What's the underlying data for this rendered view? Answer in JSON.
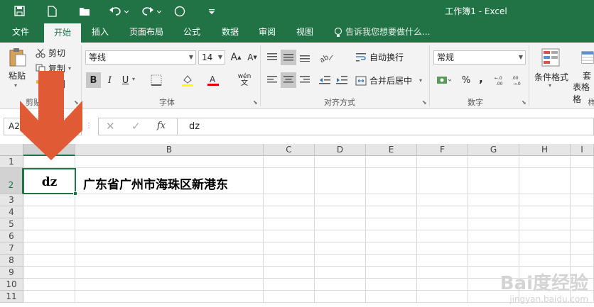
{
  "window": {
    "title": "工作簿1 - Excel"
  },
  "tabs": [
    {
      "label": "文件"
    },
    {
      "label": "开始"
    },
    {
      "label": "插入"
    },
    {
      "label": "页面布局"
    },
    {
      "label": "公式"
    },
    {
      "label": "数据"
    },
    {
      "label": "审阅"
    },
    {
      "label": "视图"
    }
  ],
  "tell_me": "告诉我您想要做什么...",
  "clipboard": {
    "paste": "粘贴",
    "cut": "剪切",
    "copy": "复制",
    "format_painter": "式刷",
    "group": "剪贴"
  },
  "font": {
    "name": "等线",
    "size": "14",
    "bold": "B",
    "italic": "I",
    "underline": "U",
    "phonetic": "wén",
    "group": "字体"
  },
  "alignment": {
    "wrap": "自动换行",
    "merge": "合并后居中",
    "group": "对齐方式"
  },
  "number": {
    "format": "常规",
    "percent": "%",
    "comma": ",",
    "group": "数字"
  },
  "styles": {
    "conditional": "条件格式",
    "table1": "套",
    "table2": "表格格",
    "group": "样"
  },
  "formula_bar": {
    "name_box": "A2",
    "fx": "fx",
    "content": "dz"
  },
  "columns": [
    "A",
    "B",
    "C",
    "D",
    "E",
    "F",
    "G",
    "H",
    "I"
  ],
  "rows": [
    "1",
    "2",
    "3",
    "4",
    "5",
    "6",
    "7",
    "8",
    "9",
    "10",
    "11"
  ],
  "cells": {
    "A2": "dz",
    "B2": "广东省广州市海珠区新港东"
  },
  "watermark": {
    "brand": "Bai度经验",
    "url": "jingyan.baidu.com"
  },
  "colors": {
    "accent": "#217346",
    "arrow": "#e05a35"
  }
}
